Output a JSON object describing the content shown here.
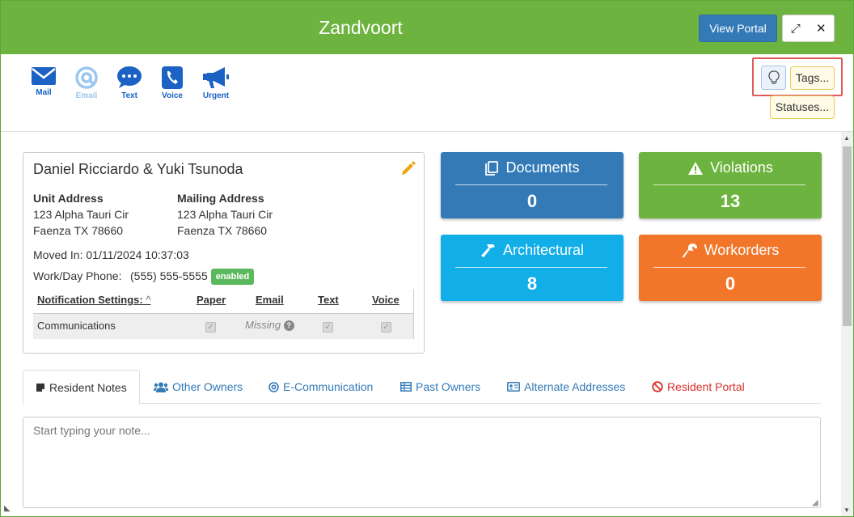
{
  "header": {
    "title": "Zandvoort",
    "view_portal": "View Portal",
    "expand_glyph": "⤢",
    "close_glyph": "✕",
    "color": "#6db33f"
  },
  "comm_toolbar": {
    "items": [
      {
        "label": "Mail",
        "icon": "mail-icon"
      },
      {
        "label": "Email",
        "icon": "at-icon",
        "disabled": true
      },
      {
        "label": "Text",
        "icon": "chat-icon"
      },
      {
        "label": "Voice",
        "icon": "phone-icon"
      },
      {
        "label": "Urgent",
        "icon": "megaphone-icon"
      }
    ]
  },
  "tags": {
    "tags_label": "Tags...",
    "statuses_label": "Statuses..."
  },
  "resident": {
    "name": "Daniel Ricciardo & Yuki Tsunoda",
    "unit_address_label": "Unit Address",
    "unit_address_line1": "123 Alpha Tauri Cir",
    "unit_address_line2": "Faenza TX 78660",
    "mailing_address_label": "Mailing Address",
    "mailing_address_line1": "123 Alpha Tauri Cir",
    "mailing_address_line2": "Faenza TX 78660",
    "moved_in": "Moved In: 01/11/2024 10:37:03",
    "phone_label": "Work/Day Phone:",
    "phone_value": "(555) 555-5555",
    "phone_badge": "enabled"
  },
  "notifications": {
    "header_label": "Notification Settings:",
    "sort_glyph": "^",
    "columns": [
      "Paper",
      "Email",
      "Text",
      "Voice"
    ],
    "row_label": "Communications",
    "email_status": "Missing",
    "check_glyph": "✓",
    "help_glyph": "?"
  },
  "tiles": [
    {
      "label": "Documents",
      "value": "0",
      "color": "#337ab7",
      "icon": "documents-icon"
    },
    {
      "label": "Violations",
      "value": "13",
      "color": "#6db33f",
      "icon": "warning-icon"
    },
    {
      "label": "Architectural",
      "value": "8",
      "color": "#11aee8",
      "icon": "hammer-icon"
    },
    {
      "label": "Workorders",
      "value": "0",
      "color": "#f1762a",
      "icon": "wrench-icon"
    }
  ],
  "tabs": [
    {
      "label": "Resident Notes",
      "icon": "note-icon"
    },
    {
      "label": "Other Owners",
      "icon": "users-icon"
    },
    {
      "label": "E-Communication",
      "icon": "at-icon"
    },
    {
      "label": "Past Owners",
      "icon": "table-icon"
    },
    {
      "label": "Alternate Addresses",
      "icon": "address-card-icon"
    },
    {
      "label": "Resident Portal",
      "icon": "ban-icon"
    }
  ],
  "note": {
    "placeholder": "Start typing your note..."
  }
}
